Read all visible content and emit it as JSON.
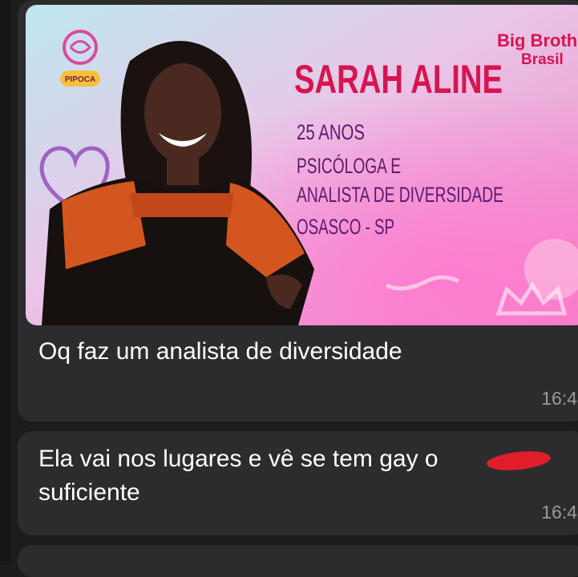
{
  "messages": [
    {
      "image_card": {
        "logo_lines": [
          "Big Brother",
          "Brasil"
        ],
        "badge": "PIPOCA",
        "name": "SARAH ALINE",
        "details": [
          "25 ANOS",
          "PSICÓLOGA E",
          "ANALISTA DE DIVERSIDADE",
          "OSASCO - SP"
        ]
      },
      "text": "Oq faz um analista de diversidade",
      "time": "16:4"
    },
    {
      "text_line1": "Ela vai nos lugares e vê se tem gay o",
      "text_line2": "suficiente",
      "time": "16:4"
    }
  ],
  "colors": {
    "bubble": "#2c2c2e",
    "name_red": "#d6154f",
    "detail_purple": "#5b1a6e",
    "redaction": "#e11d2c"
  }
}
